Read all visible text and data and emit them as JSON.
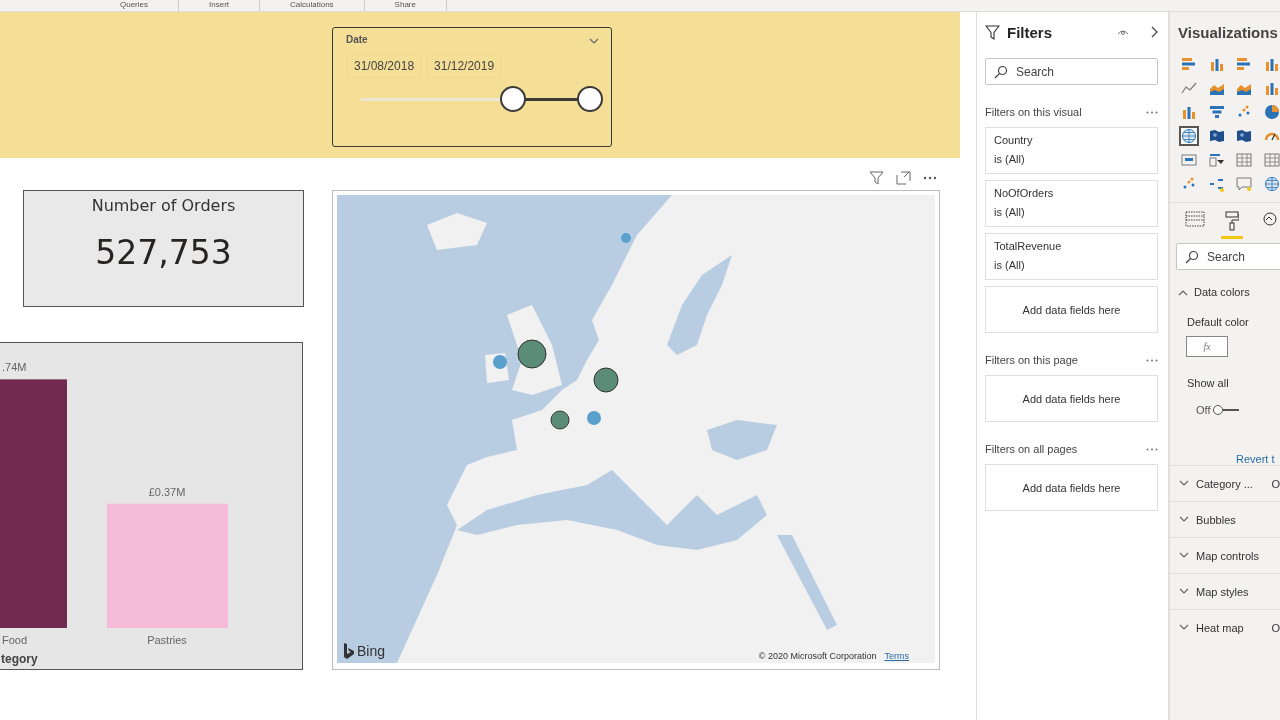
{
  "ribbon": {
    "groups": [
      "Queries",
      "Insert",
      "Calculations",
      "Share"
    ]
  },
  "slicer": {
    "title": "Date",
    "from": "31/08/2018",
    "to": "31/12/2019",
    "thumbs": [
      {
        "level": 0.63
      },
      {
        "level": 0.95
      }
    ]
  },
  "card": {
    "title": "Number of Orders",
    "value": "527,753"
  },
  "bar_chart": {
    "chart_data": {
      "type": "bar",
      "categories": [
        "Food",
        "Pastries"
      ],
      "xlabel": "tegory",
      "values": [
        0.74,
        0.37
      ],
      "data_labels": true,
      "value_labels": [
        ".74M",
        "£0.37M"
      ]
    },
    "bars": [
      {
        "color": "#722a50"
      },
      {
        "color": "#f6bad9"
      }
    ]
  },
  "map": {
    "kind": "picture",
    "logo_text": "Bing",
    "attribution": "© 2020 Microsoft Corporation",
    "terms_link": "Terms"
  },
  "filters": {
    "title": "Filters",
    "search": {
      "placeholder": "Search"
    },
    "sections": [
      {
        "title": "Filters on this visual",
        "cards": [
          {
            "field": "Country",
            "condition": "is (All)"
          },
          {
            "field": "NoOfOrders",
            "condition": "is (All)"
          },
          {
            "field": "TotalRevenue",
            "condition": "is (All)"
          }
        ],
        "drop_zone": "Add data fields here"
      },
      {
        "title": "Filters on this page",
        "drop_zone": "Add data fields here"
      },
      {
        "title": "Filters on all pages",
        "drop_zone": "Add data fields here"
      }
    ]
  },
  "visualizations": {
    "title": "Visualizations",
    "gallery": [
      {
        "kind": "bar",
        "selected": false
      },
      {
        "kind": "column",
        "selected": false
      },
      {
        "kind": "bar",
        "selected": false
      },
      {
        "kind": "column",
        "selected": false
      },
      {
        "kind": "line",
        "selected": false
      },
      {
        "kind": "area",
        "selected": false
      },
      {
        "kind": "area",
        "selected": false
      },
      {
        "kind": "column",
        "selected": false
      },
      {
        "kind": "column",
        "selected": false
      },
      {
        "kind": "funnel",
        "selected": false
      },
      {
        "kind": "scatter",
        "selected": false
      },
      {
        "kind": "pie",
        "selected": false
      },
      {
        "kind": "globe",
        "selected": true
      },
      {
        "kind": "map",
        "selected": false
      },
      {
        "kind": "map",
        "selected": false
      },
      {
        "kind": "gauge",
        "selected": false
      },
      {
        "kind": "card",
        "selected": false
      },
      {
        "kind": "slicer",
        "selected": false
      },
      {
        "kind": "table",
        "selected": false
      },
      {
        "kind": "table",
        "selected": false
      },
      {
        "kind": "scatter",
        "selected": false
      },
      {
        "kind": "tree",
        "selected": false
      },
      {
        "kind": "chat",
        "selected": false
      },
      {
        "kind": "globe",
        "selected": false
      }
    ],
    "tabs": [
      {
        "kind": "fields",
        "selected": false
      },
      {
        "kind": "format",
        "selected": true
      },
      {
        "kind": "analytics",
        "selected": false
      }
    ],
    "search": {
      "placeholder": "Search"
    },
    "data_colors": {
      "title": "Data colors",
      "expanded": true,
      "default_color_label": "Default color",
      "fx_button": "fx",
      "show_all_label": "Show all",
      "show_all_toggle": {
        "label": "Off",
        "on": false
      },
      "revert_link": "Revert t"
    },
    "sections": [
      {
        "title": "Category ...",
        "value": "O",
        "expanded": false
      },
      {
        "title": "Bubbles",
        "expanded": false
      },
      {
        "title": "Map controls",
        "expanded": false
      },
      {
        "title": "Map styles",
        "expanded": false
      },
      {
        "title": "Heat map",
        "value": "O",
        "expanded": false
      }
    ]
  }
}
